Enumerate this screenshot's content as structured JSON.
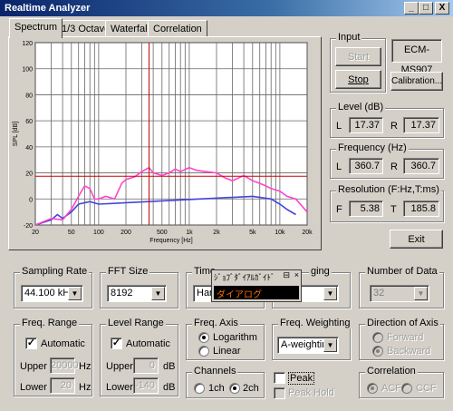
{
  "window": {
    "title": "Realtime Analyzer",
    "controls": [
      "_",
      "□",
      "X"
    ]
  },
  "tabs": [
    {
      "label": "Spectrum",
      "active": true
    },
    {
      "label": "1/3 Octave"
    },
    {
      "label": "Waterfall"
    },
    {
      "label": "Correlation"
    }
  ],
  "chart_data": {
    "type": "line",
    "title": "",
    "xlabel": "Frequency  [Hz]",
    "ylabel": "SPL  [dB]",
    "x_scale": "log",
    "xlim": [
      20,
      20000
    ],
    "ylim": [
      -20,
      120
    ],
    "x_ticks": [
      20,
      50,
      100,
      200,
      500,
      1000,
      2000,
      5000,
      10000,
      20000
    ],
    "x_tick_labels": [
      "20",
      "50",
      "100",
      "200",
      "500",
      "1k",
      "2k",
      "5k",
      "10k",
      "20k"
    ],
    "y_ticks": [
      120,
      100,
      80,
      60,
      40,
      20,
      0,
      -20
    ],
    "grid": true,
    "cursor": {
      "x": 360,
      "y": 17.4
    },
    "series": [
      {
        "color": "#ff44cc",
        "x": [
          20,
          30,
          40,
          50,
          60,
          70,
          80,
          90,
          100,
          120,
          150,
          180,
          200,
          250,
          300,
          360,
          400,
          500,
          600,
          700,
          800,
          1000,
          1200,
          1500,
          2000,
          2500,
          3000,
          4000,
          5000,
          6000,
          7000,
          8000,
          10000,
          12000,
          15000,
          20000
        ],
        "values": [
          -20,
          -15,
          -16,
          -8,
          2,
          10,
          8,
          0,
          0,
          2,
          0,
          12,
          15,
          17,
          21,
          24,
          20,
          18,
          20,
          23,
          21,
          24,
          22,
          21,
          20,
          16,
          14,
          18,
          14,
          12,
          10,
          8,
          6,
          2,
          0,
          -10
        ]
      },
      {
        "color": "#4444dd",
        "x": [
          20,
          30,
          35,
          40,
          50,
          60,
          80,
          100,
          5000,
          8000,
          10000,
          12000,
          15000
        ],
        "values": [
          -20,
          -16,
          -12,
          -15,
          -10,
          -4,
          -2,
          -4,
          2,
          0,
          -4,
          -8,
          -12
        ]
      }
    ]
  },
  "input": {
    "legend": "Input",
    "start_label": "Start",
    "stop_label": "Stop",
    "device": "ECM-MS907",
    "calibration_label": "Calibration..."
  },
  "level": {
    "legend": "Level (dB)",
    "l_label": "L",
    "l_value": "17.37",
    "r_label": "R",
    "r_value": "17.37"
  },
  "frequency": {
    "legend": "Frequency (Hz)",
    "l_label": "L",
    "l_value": "360.7",
    "r_label": "R",
    "r_value": "360.7"
  },
  "resolution": {
    "legend": "Resolution (F:Hz,T:ms)",
    "f_label": "F",
    "f_value": "5.38",
    "t_label": "T",
    "t_value": "185.8"
  },
  "exit_label": "Exit",
  "sampling_rate": {
    "legend": "Sampling Rate",
    "value": "44.100 kHz"
  },
  "fft_size": {
    "legend": "FFT Size",
    "value": "8192"
  },
  "time_window": {
    "legend": "Time",
    "value": "Han"
  },
  "averaging": {
    "legend": "ging",
    "value": ""
  },
  "number_of_data": {
    "legend": "Number of Data",
    "value": "32"
  },
  "ime_popup": {
    "title": "ｼﾞｮﾌﾞﾀﾞｲｱﾙｶﾞｲﾄﾞ",
    "buttons": [
      "⊟",
      "×"
    ],
    "text": "ダイアログ"
  },
  "freq_range": {
    "legend": "Freq. Range",
    "automatic": "Automatic",
    "upper_label": "Upper",
    "upper_value": "20000",
    "upper_unit": "Hz",
    "lower_label": "Lower",
    "lower_value": "20",
    "lower_unit": "Hz"
  },
  "level_range": {
    "legend": "Level Range",
    "automatic": "Automatic",
    "upper_label": "Upper",
    "upper_value": "0",
    "upper_unit": "dB",
    "lower_label": "Lower",
    "lower_value": "-140",
    "lower_unit": "dB"
  },
  "freq_axis": {
    "legend": "Freq. Axis",
    "opt1": "Logarithm",
    "opt2": "Linear"
  },
  "freq_weighting": {
    "legend": "Freq. Weighting",
    "value": "A-weighting"
  },
  "direction_of_axis": {
    "legend": "Direction of Axis",
    "opt1": "Forward",
    "opt2": "Backward"
  },
  "channels": {
    "legend": "Channels",
    "opt1": "1ch",
    "opt2": "2ch"
  },
  "peak": {
    "label": "Peak",
    "hold_label": "Peak Hold"
  },
  "correlation": {
    "legend": "Correlation",
    "opt1": "ACF",
    "opt2": "CCF"
  }
}
